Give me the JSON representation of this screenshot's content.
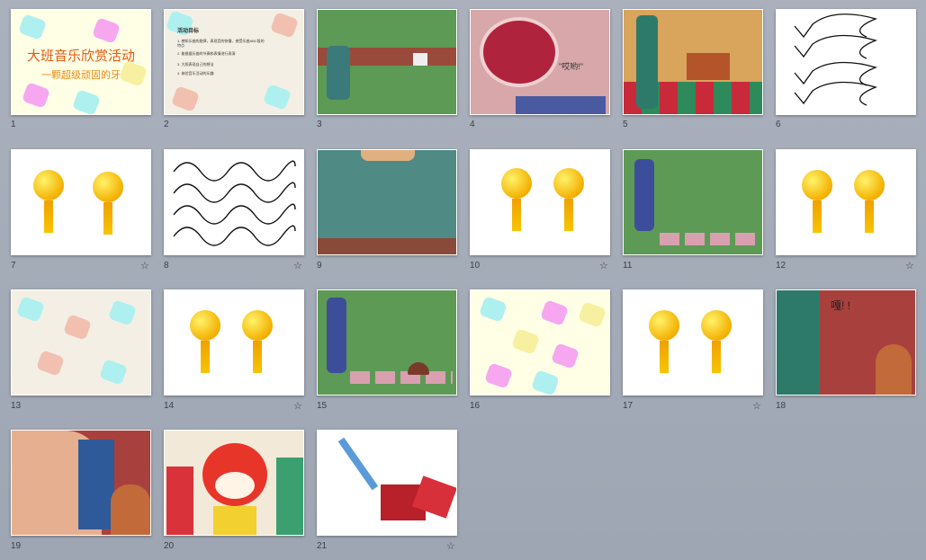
{
  "app": {
    "view": "Slide Sorter"
  },
  "slides": [
    {
      "number": "1",
      "title": "大班音乐欣赏活动",
      "subtitle": "一颗超级顽固的牙",
      "star": ""
    },
    {
      "number": "2",
      "heading": "活动目标",
      "lines": [
        "1. 感知乐曲的旋律，表现音的快慢，感受乐曲ABC段的特点",
        "2. 能根据乐曲的节奏和表情进行表演",
        "3. 大胆表现自己的想法",
        "4. 体验音乐活动的乐趣"
      ],
      "star": ""
    },
    {
      "number": "3",
      "star": ""
    },
    {
      "number": "4",
      "speech": "\"哎哟!\"",
      "star": ""
    },
    {
      "number": "5",
      "star": ""
    },
    {
      "number": "6",
      "star": ""
    },
    {
      "number": "7",
      "star": "☆"
    },
    {
      "number": "8",
      "star": "☆"
    },
    {
      "number": "9",
      "star": ""
    },
    {
      "number": "10",
      "star": "☆"
    },
    {
      "number": "11",
      "star": ""
    },
    {
      "number": "12",
      "star": "☆"
    },
    {
      "number": "13",
      "star": ""
    },
    {
      "number": "14",
      "star": "☆"
    },
    {
      "number": "15",
      "star": ""
    },
    {
      "number": "16",
      "star": ""
    },
    {
      "number": "17",
      "star": "☆"
    },
    {
      "number": "18",
      "speech": "嘎! !",
      "star": ""
    },
    {
      "number": "19",
      "star": ""
    },
    {
      "number": "20",
      "star": ""
    },
    {
      "number": "21",
      "star": "☆"
    }
  ],
  "colors": {
    "background": "#a8afbb",
    "accent_title": "#e35a13"
  }
}
